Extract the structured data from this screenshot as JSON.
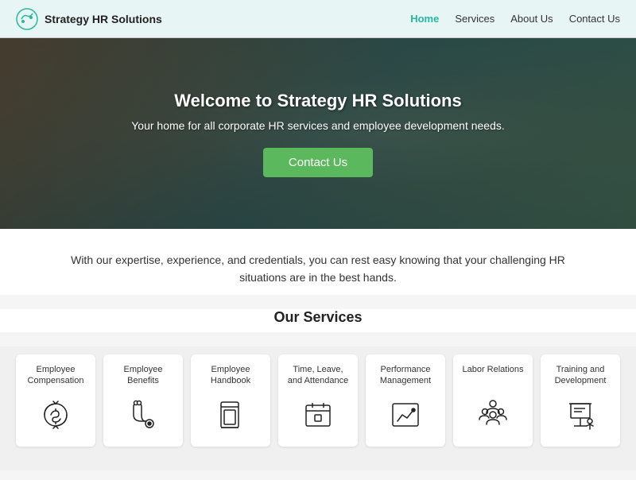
{
  "header": {
    "logo_text": "Strategy HR Solutions",
    "nav": [
      {
        "label": "Home",
        "active": true
      },
      {
        "label": "Services",
        "active": false
      },
      {
        "label": "About Us",
        "active": false
      },
      {
        "label": "Contact Us",
        "active": false
      }
    ]
  },
  "hero": {
    "title": "Welcome to Strategy HR Solutions",
    "subtitle": "Your home for all corporate HR services and employee development needs.",
    "cta_label": "Contact Us"
  },
  "tagline": {
    "text": "With our expertise, experience, and credentials, you can rest easy knowing that your challenging HR situations are in the best hands."
  },
  "services": {
    "section_title": "Our Services",
    "items": [
      {
        "label": "Employee Compensation",
        "icon": "money-cycle"
      },
      {
        "label": "Employee Benefits",
        "icon": "stethoscope"
      },
      {
        "label": "Employee Handbook",
        "icon": "book"
      },
      {
        "label": "Time, Leave, and Attendance",
        "icon": "calendar"
      },
      {
        "label": "Performance Management",
        "icon": "chart"
      },
      {
        "label": "Labor Relations",
        "icon": "people"
      },
      {
        "label": "Training and Development",
        "icon": "training"
      }
    ]
  },
  "colors": {
    "accent": "#2ab5a0",
    "cta_green": "#5cb85c",
    "nav_active": "#2ab5a0"
  }
}
